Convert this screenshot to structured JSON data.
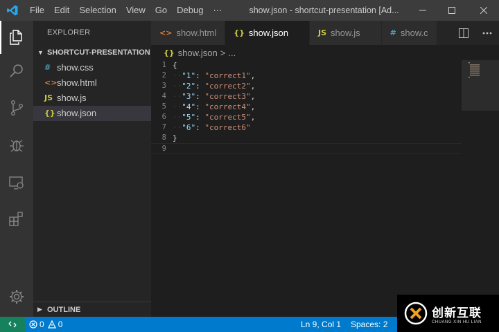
{
  "titlebar": {
    "menu": [
      "File",
      "Edit",
      "Selection",
      "View",
      "Go",
      "Debug",
      "···"
    ],
    "window_title": "show.json - shortcut-presentation [Ad..."
  },
  "activity": {
    "icons": [
      "files-icon",
      "search-icon",
      "source-control-icon",
      "debug-icon",
      "remote-explorer-icon",
      "extensions-icon",
      "settings-gear-icon"
    ]
  },
  "sidebar": {
    "title": "EXPLORER",
    "folder": "SHORTCUT-PRESENTATION",
    "files": [
      {
        "icon": "#",
        "icon_color": "#519aba",
        "name": "show.css"
      },
      {
        "icon": "<>",
        "icon_color": "#e37933",
        "name": "show.html"
      },
      {
        "icon": "JS",
        "icon_color": "#cbcb41",
        "name": "show.js"
      },
      {
        "icon": "{}",
        "icon_color": "#cbcb41",
        "name": "show.json"
      }
    ],
    "selected": "show.json",
    "outline": "OUTLINE"
  },
  "tabs": [
    {
      "icon": "<>",
      "icon_color": "#e37933",
      "label": "show.html"
    },
    {
      "icon": "{}",
      "icon_color": "#cbcb41",
      "label": "show.json"
    },
    {
      "icon": "JS",
      "icon_color": "#cbcb41",
      "label": "show.js"
    },
    {
      "icon": "#",
      "icon_color": "#519aba",
      "label": "show.c"
    }
  ],
  "active_tab": "show.json",
  "breadcrumb": {
    "file": "show.json",
    "sep": ">",
    "rest": "..."
  },
  "editor": {
    "lines": [
      {
        "n": "1",
        "text": "{"
      },
      {
        "n": "2",
        "key": "\"1\"",
        "value": "\"correct1\"",
        "comma": ","
      },
      {
        "n": "3",
        "key": "\"2\"",
        "value": "\"correct2\"",
        "comma": ","
      },
      {
        "n": "4",
        "key": "\"3\"",
        "value": "\"correct3\"",
        "comma": ","
      },
      {
        "n": "5",
        "key": "\"4\"",
        "value": "\"correct4\"",
        "comma": ","
      },
      {
        "n": "6",
        "key": "\"5\"",
        "value": "\"correct5\"",
        "comma": ","
      },
      {
        "n": "7",
        "key": "\"6\"",
        "value": "\"correct6\"",
        "comma": ""
      },
      {
        "n": "8",
        "text": "}"
      },
      {
        "n": "9",
        "text": ""
      }
    ]
  },
  "status": {
    "errors": "0",
    "warnings": "0",
    "position": "Ln 9, Col 1",
    "spaces": "Spaces: 2"
  },
  "watermark": {
    "cn": "创新互联",
    "en": "CHUANG XIN HU LIAN"
  },
  "colors": {
    "accent": "#007acc",
    "remote": "#16825d"
  }
}
